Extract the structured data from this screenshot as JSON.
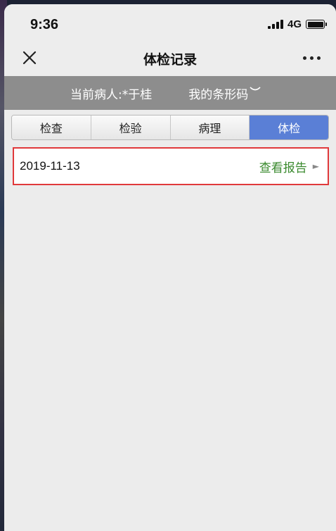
{
  "status_bar": {
    "time": "9:36",
    "network": "4G",
    "battery_level": 1.0
  },
  "nav": {
    "title": "体检记录"
  },
  "patient_bar": {
    "patient_label": "当前病人:*于桂",
    "barcode_label": "我的条形码"
  },
  "tabs": [
    {
      "label": "检查",
      "active": false
    },
    {
      "label": "检验",
      "active": false
    },
    {
      "label": "病理",
      "active": false
    },
    {
      "label": "体检",
      "active": true
    }
  ],
  "records": [
    {
      "date": "2019-11-13",
      "action_label": "查看报告"
    }
  ],
  "colors": {
    "active_tab": "#5a7fd6",
    "action_text": "#3a8a2e",
    "highlight_border": "#e0393b",
    "patient_bar_bg": "#8d8d8d"
  }
}
